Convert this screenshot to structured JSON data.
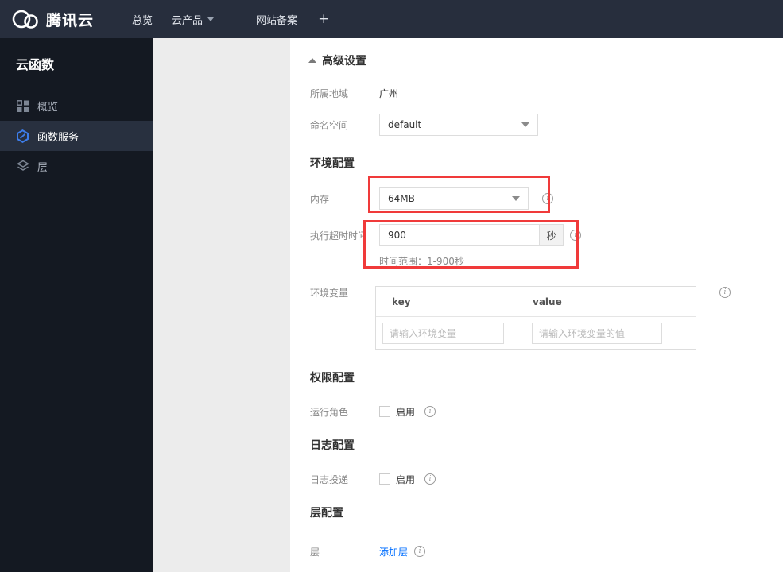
{
  "navbar": {
    "brand": "腾讯云",
    "items": [
      {
        "label": "总览"
      },
      {
        "label": "云产品"
      },
      {
        "label": "网站备案"
      }
    ],
    "plus_label": "+"
  },
  "sidebar": {
    "title": "云函数",
    "items": [
      {
        "label": "概览"
      },
      {
        "label": "函数服务"
      },
      {
        "label": "层"
      }
    ]
  },
  "main": {
    "advanced_toggle": "高级设置",
    "sections": {
      "env": "环境配置",
      "permission": "权限配置",
      "log": "日志配置",
      "layer": "层配置"
    },
    "fields": {
      "region": {
        "label": "所属地域",
        "value": "广州"
      },
      "namespace": {
        "label": "命名空间",
        "value": "default"
      },
      "memory": {
        "label": "内存",
        "value": "64MB"
      },
      "timeout": {
        "label": "执行超时时间",
        "value": "900",
        "unit": "秒",
        "hint": "时间范围：1-900秒"
      },
      "env_vars": {
        "label": "环境变量",
        "key_header": "key",
        "value_header": "value",
        "key_placeholder": "请输入环境变量",
        "value_placeholder": "请输入环境变量的值"
      },
      "run_role": {
        "label": "运行角色",
        "checkbox_label": "启用"
      },
      "log_delivery": {
        "label": "日志投递",
        "checkbox_label": "启用"
      },
      "layer": {
        "label": "层",
        "link_label": "添加层"
      }
    },
    "info_icon_glyph": "i",
    "colors": {
      "highlight_red": "#f03a3a",
      "link_blue": "#006eff",
      "brand_dark": "#272e3d"
    }
  }
}
